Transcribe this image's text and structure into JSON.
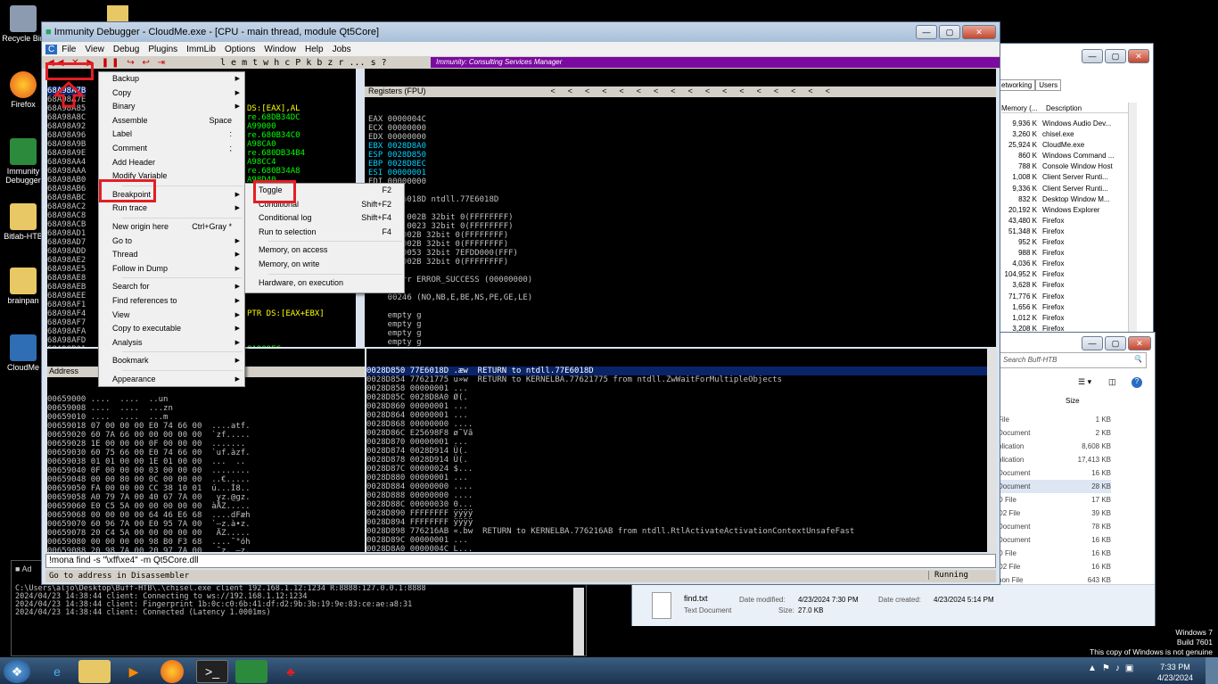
{
  "desktop": {
    "icons": [
      "Recycle Bin",
      "Firefox",
      "Immunity Debugger",
      "Bitlab-HTB",
      "brainpan",
      "CloudMe"
    ]
  },
  "debugger": {
    "title": "Immunity Debugger - CloudMe.exe - [CPU - main thread, module Qt5Core]",
    "menus": [
      "File",
      "View",
      "Debug",
      "Plugins",
      "ImmLib",
      "Options",
      "Window",
      "Help",
      "Jobs"
    ],
    "toolbar_letters": "l  e  m  t  w  h  c  P  k  b  z  r  ...  s  ?",
    "banner": "Immunity: Consulting Services Manager",
    "disasm_rows": [
      "68A98A7B",
      "68A98A7E",
      "68A98A85",
      "68A98A8C",
      "68A98A92",
      "68A98A96",
      "68A98A9B",
      "68A98A9E",
      "68A98AA4",
      "68A98AAA",
      "68A98AB0",
      "68A98AB6",
      "68A98ABC",
      "68A98AC2",
      "68A98AC8",
      "68A98ACB",
      "68A98AD1",
      "68A98AD7",
      "68A98ADD",
      "68A98AE2",
      "68A98AE5",
      "68A98AE8",
      "68A98AEB",
      "68A98AEE",
      "68A98AF1",
      "68A98AF4",
      "68A98AF7",
      "68A98AFA",
      "68A98AFD",
      "68A98B01",
      "68A98B07"
    ],
    "disasm_selected": "68A98A7B",
    "disasm_right": [
      "",
      "",
      "DS:[EAX],AL",
      "re.68DB34DC",
      "A99000",
      "re.680B34C0",
      "A98CA0",
      "re.680DB34B4",
      "A98CC4",
      "re.680B34A8",
      "A98D40",
      "",
      "",
      "",
      "",
      "",
      "",
      "",
      "",
      "",
      "",
      "",
      "",
      "",
      "",
      "PTR DS:[EAX+EBX]",
      "",
      "",
      "",
      "8A989FC",
      "re.68FF30E0"
    ],
    "registers_title": "Registers (FPU)",
    "registers": [
      "EAX 0000004C",
      "ECX 00000000",
      "EDX 00000000",
      "EBX 0028D8A0",
      "ESP 0028D850",
      "EBP 0028D8EC",
      "ESI 00000001",
      "EDI 00000000",
      "",
      "EIP 77E6018D ntdll.77E6018D",
      "",
      "C 0  ES 002B 32bit 0(FFFFFFFF)",
      "P 1  CS 0023 32bit 0(FFFFFFFF)",
      "       002B 32bit 0(FFFFFFFF)",
      "       002B 32bit 0(FFFFFFFF)",
      "       0053 32bit 7EFDD000(FFF)",
      "       002B 32bit 0(FFFFFFFF)",
      "",
      "    stErr ERROR_SUCCESS (00000000)",
      "",
      "    00246 (NO,NB,E,BE,NS,PE,GE,LE)",
      "",
      "    empty g",
      "    empty g",
      "    empty g",
      "    empty g",
      "ST4 empty g",
      "ST5 empty g",
      "ST6 empty g",
      "ST7 empty g",
      "",
      "                3 2 1 0      E S P U O Z D I",
      "FST 4020  Cond 1 0 0 0  Err 0 0 1 0 0 0 0 0  (EQ)"
    ],
    "dump_header": "Address",
    "dump_rows": [
      "00659000 ....  ....  ..un",
      "00659008 ....  ....  ...zn",
      "00659010 ....  ....  ...m",
      "00659018 07 00 00 00 E0 74 66 00  ....atf.",
      "00659020 60 7A 66 00 00 00 00 00  `zf.....",
      "00659028 1E 00 00 00 0F 00 00 00  .......",
      "00659030 60 75 66 00 E0 74 66 00  `uf.àzf.",
      "00659038 01 01 00 00 1E 01 00 00  ...  ..",
      "00659040 0F 00 00 00 03 00 00 00  ........",
      "00659048 00 00 80 00 0C 00 00 00  ..€.....",
      "00659050 FA 00 00 00 CC 38 10 01  ú...Ì8..",
      "00659058 A0 79 7A 00 40 67 7A 00   yz.@gz.",
      "00659060 E0 C5 5A 00 00 00 00 00  àÅZ.....",
      "00659068 00 00 00 00 64 46 E6 68  ....dFæh",
      "00659070 60 96 7A 00 E0 95 7A 00  `–z.à•z.",
      "00659078 20 C4 5A 00 00 00 00 00   ÄZ.....",
      "00659080 00 00 00 00 98 B0 F3 68  ....˜°óh",
      "00659088 20 98 7A 00 20 97 7A 00   ˜z. —z.",
      "00659090 20 EA 5A 00 00 00 00 00   êZ.....",
      "00659098 00 00 00 00 98 B0 F3 68  ....˜°óh",
      "006590A0 60 9A 7A 00 80 99 7A 00  `šz.€™z.",
      "006590A8 00 E2 5A 00 00 00 00 00  .âZ....."
    ],
    "stack_rows": [
      {
        "addr": "0028D850",
        "val": "77E6018D",
        "txt": " .æw  RETURN to ntdll.77E6018D"
      },
      {
        "addr": "0028D854",
        "val": "77621775",
        "txt": " u»w  RETURN to KERNELBA.77621775 from ntdll.ZwWaitForMultipleObjects"
      },
      {
        "addr": "0028D858",
        "val": "00000001",
        "txt": " ..."
      },
      {
        "addr": "0028D85C",
        "val": "0028D8A0",
        "txt": " Ø(."
      },
      {
        "addr": "0028D860",
        "val": "00000001",
        "txt": " ..."
      },
      {
        "addr": "0028D864",
        "val": "00000001",
        "txt": " ..."
      },
      {
        "addr": "0028D868",
        "val": "00000000",
        "txt": " ...."
      },
      {
        "addr": "0028D86C",
        "val": "E25698F8",
        "txt": " ø˜Vâ"
      },
      {
        "addr": "0028D870",
        "val": "00000001",
        "txt": " ..."
      },
      {
        "addr": "0028D874",
        "val": "0028D914",
        "txt": " Ù(."
      },
      {
        "addr": "0028D878",
        "val": "0028D914",
        "txt": " Ù(."
      },
      {
        "addr": "0028D87C",
        "val": "00000024",
        "txt": " $..."
      },
      {
        "addr": "0028D880",
        "val": "00000001",
        "txt": " ..."
      },
      {
        "addr": "0028D884",
        "val": "00000000",
        "txt": " ...."
      },
      {
        "addr": "0028D888",
        "val": "00000000",
        "txt": " ...."
      },
      {
        "addr": "0028D88C",
        "val": "00000030",
        "txt": " 0..."
      },
      {
        "addr": "0028D890",
        "val": "FFFFFFFF",
        "txt": " ÿÿÿÿ"
      },
      {
        "addr": "0028D894",
        "val": "FFFFFFFF",
        "txt": " ÿÿÿÿ"
      },
      {
        "addr": "0028D898",
        "val": "776216AB",
        "txt": " «.bw  RETURN to KERNELBA.776216AB from ntdll.RtlActivateActivationContextUnsafeFast"
      },
      {
        "addr": "0028D89C",
        "val": "00000001",
        "txt": " ..."
      },
      {
        "addr": "0028D8A0",
        "val": "0000004C",
        "txt": " L..."
      },
      {
        "addr": "0028D8A4",
        "val": "0028D8CC",
        "txt": " ÌØ(."
      },
      {
        "addr": "0028D8A8",
        "val": "00000000",
        "txt": " ...."
      }
    ],
    "command": "!mona find -s \"\\xff\\xe4\" -m Qt5Core.dll",
    "status_left": "Go to address in Disassembler",
    "status_right": "Running"
  },
  "context_menu": {
    "items": [
      {
        "label": "Backup",
        "arrow": "▶"
      },
      {
        "label": "Copy",
        "arrow": "▶"
      },
      {
        "label": "Binary",
        "arrow": "▶"
      },
      {
        "label": "Assemble",
        "sc": "Space"
      },
      {
        "label": "Label",
        "sc": ":"
      },
      {
        "label": "Comment",
        "sc": ";"
      },
      {
        "label": "Add Header"
      },
      {
        "label": "Modify Variable"
      },
      {
        "label": "Breakpoint",
        "arrow": "▶",
        "sep": true
      },
      {
        "label": "Run trace",
        "arrow": "▶"
      },
      {
        "label": "New origin here",
        "sc": "Ctrl+Gray *",
        "sep": true
      },
      {
        "label": "Go to",
        "arrow": "▶"
      },
      {
        "label": "Thread",
        "arrow": "▶"
      },
      {
        "label": "Follow in Dump",
        "arrow": "▶"
      },
      {
        "label": "Search for",
        "arrow": "▶",
        "sep": true
      },
      {
        "label": "Find references to",
        "arrow": "▶"
      },
      {
        "label": "View",
        "arrow": "▶"
      },
      {
        "label": "Copy to executable",
        "arrow": "▶"
      },
      {
        "label": "Analysis",
        "arrow": "▶"
      },
      {
        "label": "Bookmark",
        "arrow": "▶",
        "sep": true
      },
      {
        "label": "Appearance",
        "arrow": "▶",
        "sep": true
      }
    ]
  },
  "submenu": {
    "items": [
      {
        "label": "Toggle",
        "sc": "F2"
      },
      {
        "label": "Conditional",
        "sc": "Shift+F2"
      },
      {
        "label": "Conditional log",
        "sc": "Shift+F4"
      },
      {
        "label": "Run to selection",
        "sc": "F4"
      },
      {
        "label": "Memory, on access",
        "sep": true
      },
      {
        "label": "Memory, on write"
      },
      {
        "label": "Hardware, on execution",
        "sep": true
      }
    ]
  },
  "taskmgr": {
    "tabs": [
      "etworking",
      "Users"
    ],
    "cols": [
      "Memory (...",
      "Description"
    ],
    "rows": [
      [
        "9,936 K",
        "Windows Audio Dev..."
      ],
      [
        "3,260 K",
        "chisel.exe"
      ],
      [
        "25,924 K",
        "CloudMe.exe"
      ],
      [
        "860 K",
        "Windows Command ..."
      ],
      [
        "788 K",
        "Console Window Host"
      ],
      [
        "1,008 K",
        "Client Server Runti..."
      ],
      [
        "9,336 K",
        "Client Server Runti..."
      ],
      [
        "832 K",
        "Desktop Window M..."
      ],
      [
        "20,192 K",
        "Windows Explorer"
      ],
      [
        "43,480 K",
        "Firefox"
      ],
      [
        "51,348 K",
        "Firefox"
      ],
      [
        "952 K",
        "Firefox"
      ],
      [
        "988 K",
        "Firefox"
      ],
      [
        "4,036 K",
        "Firefox"
      ],
      [
        "104,952 K",
        "Firefox"
      ],
      [
        "3,628 K",
        "Firefox"
      ],
      [
        "71,776 K",
        "Firefox"
      ],
      [
        "1,656 K",
        "Firefox"
      ],
      [
        "1,012 K",
        "Firefox"
      ],
      [
        "3,208 K",
        "Firefox"
      ]
    ]
  },
  "explorer": {
    "search": "Search Buff-HTB",
    "col_size": "Size",
    "rows": [
      [
        "File",
        "1 KB"
      ],
      [
        "Document",
        "2 KB"
      ],
      [
        "plication",
        "8,608 KB"
      ],
      [
        "plication",
        "17,413 KB"
      ],
      [
        "Document",
        "16 KB"
      ],
      [
        "Document",
        "28 KB"
      ],
      [
        "D File",
        "17 KB"
      ],
      [
        "D2 File",
        "39 KB"
      ],
      [
        "Document",
        "78 KB"
      ],
      [
        "Document",
        "16 KB"
      ],
      [
        "D File",
        "16 KB"
      ],
      [
        "D2 File",
        "16 KB"
      ],
      [
        "hon File",
        "643 KB"
      ]
    ],
    "detail_name": "find.txt",
    "detail_type": "Text Document",
    "modified_label": "Date modified:",
    "modified": "4/23/2024 7:30 PM",
    "created_label": "Date created:",
    "created": "4/23/2024 5:14 PM",
    "size_label": "Size:",
    "size": "27.0 KB"
  },
  "console": {
    "title": "Ad",
    "lines": [
      "C:\\Users\\aljö\\Desktop\\Buff-HTB\\.\\chisel.exe client 192.168.1.12:1234 R:8888:127.0.0.1:8888",
      "2024/04/23 14:38:44 client: Connecting to ws://192.168.1.12:1234",
      "2024/04/23 14:38:44 client: Fingerprint 1b:0c:c0:6b:41:df:d2:9b:3b:19:9e:83:ce:ae:a8:31",
      "2024/04/23 14:38:44 client: Connected (Latency 1.0001ms)"
    ]
  },
  "watermark": [
    "Windows 7",
    "Build 7601",
    "This copy of Windows is not genuine"
  ],
  "clock": {
    "time": "7:33 PM",
    "date": "4/23/2024"
  }
}
